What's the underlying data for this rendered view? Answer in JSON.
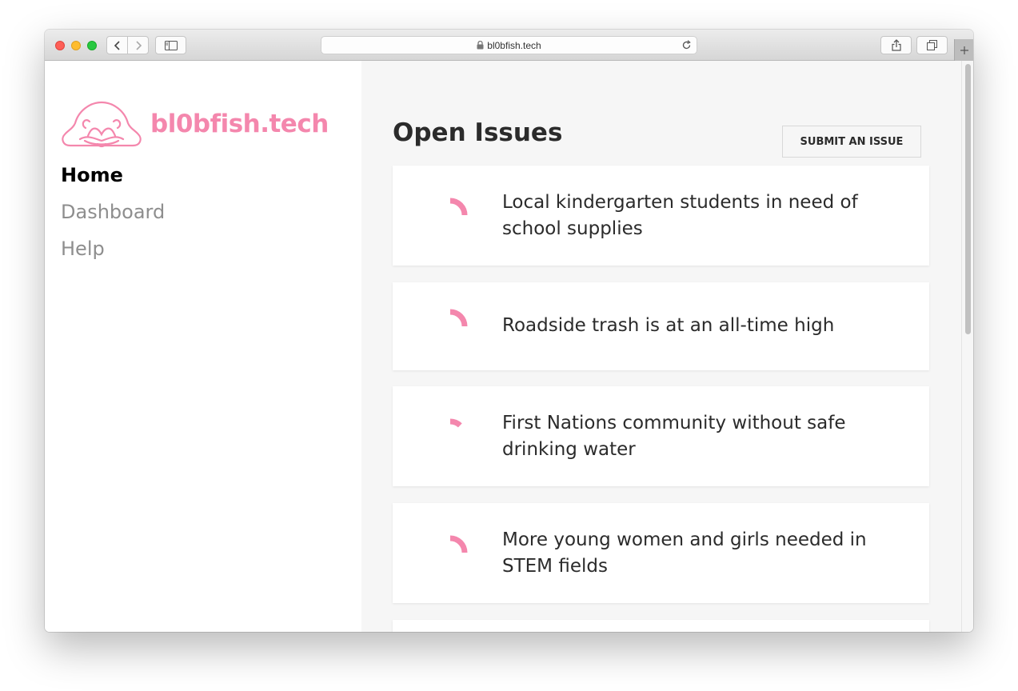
{
  "browser": {
    "url": "bl0bfish.tech"
  },
  "brand": {
    "name": "bl0bfish.tech",
    "color": "#f487ad"
  },
  "nav": {
    "items": [
      {
        "label": "Home",
        "active": true
      },
      {
        "label": "Dashboard",
        "active": false
      },
      {
        "label": "Help",
        "active": false
      }
    ]
  },
  "main": {
    "title": "Open Issues",
    "submit_label": "SUBMIT AN ISSUE",
    "issues": [
      {
        "title": "Local kindergarten students in need of school supplies",
        "progress": 0.25
      },
      {
        "title": "Roadside trash is at an all-time high",
        "progress": 0.25
      },
      {
        "title": "First Nations community without safe drinking water",
        "progress": 0.12
      },
      {
        "title": "More young women and girls needed in STEM fields",
        "progress": 0.25
      }
    ]
  }
}
